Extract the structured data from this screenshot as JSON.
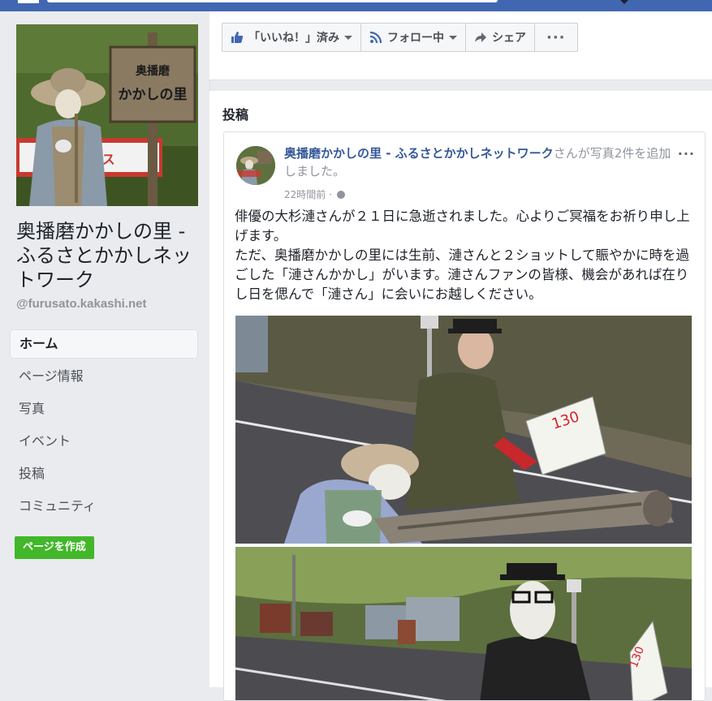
{
  "page": {
    "name": "奥播磨かかしの里 - ふるさとかかしネットワーク",
    "handle": "@furusato.kakashi.net",
    "cover_sign_line1": "奥播磨",
    "cover_sign_line2": "かかしの里"
  },
  "nav": {
    "items": [
      "ホーム",
      "ページ情報",
      "写真",
      "イベント",
      "投稿",
      "コミュニティ"
    ],
    "active": "ホーム",
    "create_page": "ページを作成"
  },
  "actions": {
    "like": "「いいね！」済み",
    "follow": "フォロー中",
    "share": "シェア",
    "more": "···"
  },
  "posts": {
    "section_title": "投稿",
    "post": {
      "author": "奥播磨かかしの里 - ふるさとかかしネットワーク",
      "action": "さんが写真2件を追加しました。",
      "time": "22時間前 ·",
      "options": "···",
      "text": "俳優の大杉漣さんが２１日に急逝されました。心よりご冥福をお祈り申し上げます。\nただ、奥播磨かかしの里には生前、漣さんと２ショットして賑やかに時を過ごした「漣さんかかし」がいます。漣さんファンの皆様、機会があれば在りし日を偲んで「漣さん」に会いにお越しください。"
    }
  },
  "colors": {
    "fb_blue": "#4267b2",
    "link_blue": "#365899",
    "green": "#42b72a"
  }
}
